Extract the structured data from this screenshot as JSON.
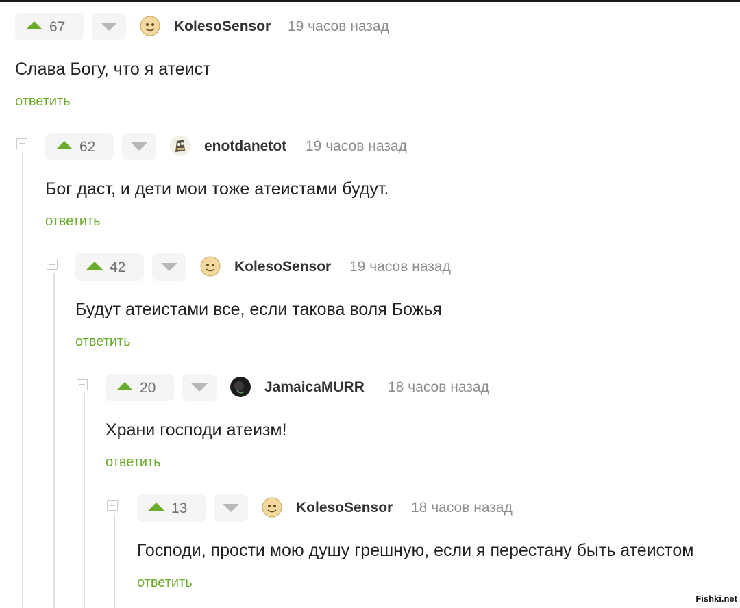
{
  "comments": [
    {
      "score": "67",
      "author": "KolesoSensor",
      "time": "19 часов назад",
      "text": "Слава Богу, что я атеист",
      "reply": "ответить",
      "avatar": "emoji-avatar"
    },
    {
      "score": "62",
      "author": "enotdanetot",
      "time": "19 часов назад",
      "text": "Бог даст, и дети мои тоже атеистами будут.",
      "reply": "ответить",
      "avatar": "raccoon-avatar"
    },
    {
      "score": "42",
      "author": "KolesoSensor",
      "time": "19 часов назад",
      "text": "Будут атеистами все, если такова воля Божья",
      "reply": "ответить",
      "avatar": "emoji-avatar"
    },
    {
      "score": "20",
      "author": "JamaicaMURR",
      "time": "18 часов назад",
      "text": "Храни господи атеизм!",
      "reply": "ответить",
      "avatar": "dark-avatar"
    },
    {
      "score": "13",
      "author": "KolesoSensor",
      "time": "18 часов назад",
      "text": "Господи, прости мою душу грешную, если я перестану быть атеистом",
      "reply": "ответить",
      "avatar": "emoji-avatar"
    }
  ],
  "watermark": "Fishki.net",
  "colors": {
    "upvote": "#6aab2c",
    "reply": "#6aab2c",
    "downvote": "#b7b7b7",
    "vote_bg": "#f5f5f5"
  }
}
